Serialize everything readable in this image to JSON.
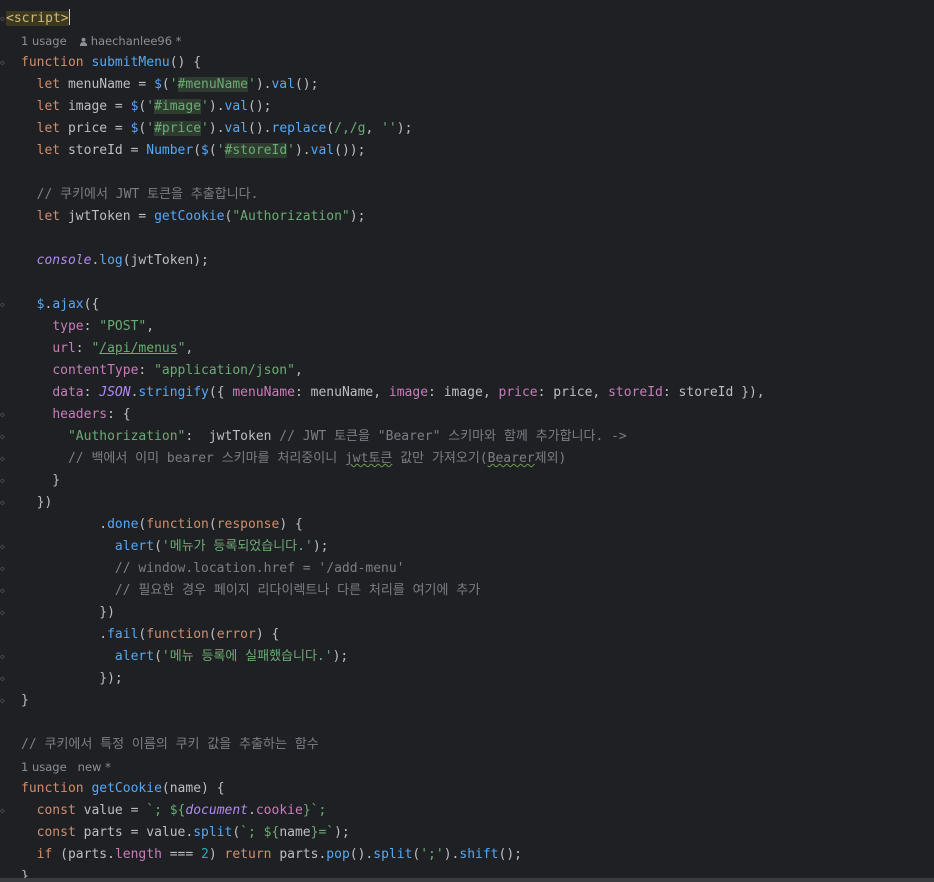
{
  "editor": {
    "lines": [
      {
        "tokens": [
          {
            "t": "<script>",
            "c": "hl-tag"
          }
        ],
        "caret": true
      },
      {
        "meta": true,
        "usage": "1 usage",
        "author": "haechanlee96 *"
      },
      {
        "tokens": [
          {
            "t": "function ",
            "c": "kw"
          },
          {
            "t": "submitMenu",
            "c": "fn"
          },
          {
            "t": "() {"
          }
        ]
      },
      {
        "tokens": [
          {
            "t": "  "
          },
          {
            "t": "let ",
            "c": "kw"
          },
          {
            "t": "menuName = "
          },
          {
            "t": "$",
            "c": "fn"
          },
          {
            "t": "("
          },
          {
            "t": "'",
            "c": "str"
          },
          {
            "t": "#menuName",
            "c": "str id-hl"
          },
          {
            "t": "'",
            "c": "str"
          },
          {
            "t": ")."
          },
          {
            "t": "val",
            "c": "fn"
          },
          {
            "t": "();"
          }
        ]
      },
      {
        "tokens": [
          {
            "t": "  "
          },
          {
            "t": "let ",
            "c": "kw"
          },
          {
            "t": "image = "
          },
          {
            "t": "$",
            "c": "fn"
          },
          {
            "t": "("
          },
          {
            "t": "'",
            "c": "str"
          },
          {
            "t": "#image",
            "c": "str id-hl"
          },
          {
            "t": "'",
            "c": "str"
          },
          {
            "t": ")."
          },
          {
            "t": "val",
            "c": "fn"
          },
          {
            "t": "();"
          }
        ]
      },
      {
        "tokens": [
          {
            "t": "  "
          },
          {
            "t": "let ",
            "c": "kw"
          },
          {
            "t": "price = "
          },
          {
            "t": "$",
            "c": "fn"
          },
          {
            "t": "("
          },
          {
            "t": "'",
            "c": "str"
          },
          {
            "t": "#price",
            "c": "str id-hl"
          },
          {
            "t": "'",
            "c": "str"
          },
          {
            "t": ")."
          },
          {
            "t": "val",
            "c": "fn"
          },
          {
            "t": "()."
          },
          {
            "t": "replace",
            "c": "fn"
          },
          {
            "t": "("
          },
          {
            "t": "/,/g",
            "c": "str"
          },
          {
            "t": ", "
          },
          {
            "t": "''",
            "c": "str"
          },
          {
            "t": ");"
          }
        ]
      },
      {
        "tokens": [
          {
            "t": "  "
          },
          {
            "t": "let ",
            "c": "kw"
          },
          {
            "t": "storeId = "
          },
          {
            "t": "Number",
            "c": "fn"
          },
          {
            "t": "("
          },
          {
            "t": "$",
            "c": "fn"
          },
          {
            "t": "("
          },
          {
            "t": "'",
            "c": "str"
          },
          {
            "t": "#storeId",
            "c": "str id-hl"
          },
          {
            "t": "'",
            "c": "str"
          },
          {
            "t": ")."
          },
          {
            "t": "val",
            "c": "fn"
          },
          {
            "t": "());"
          }
        ]
      },
      {
        "tokens": []
      },
      {
        "tokens": [
          {
            "t": "  "
          },
          {
            "t": "// 쿠키에서 JWT 토큰을 추출합니다.",
            "c": "cm"
          }
        ]
      },
      {
        "tokens": [
          {
            "t": "  "
          },
          {
            "t": "let ",
            "c": "kw"
          },
          {
            "t": "jwtToken = "
          },
          {
            "t": "getCookie",
            "c": "fn"
          },
          {
            "t": "("
          },
          {
            "t": "\"Authorization\"",
            "c": "str"
          },
          {
            "t": ");"
          }
        ]
      },
      {
        "tokens": []
      },
      {
        "tokens": [
          {
            "t": "  "
          },
          {
            "t": "console",
            "c": "ctx"
          },
          {
            "t": "."
          },
          {
            "t": "log",
            "c": "fn"
          },
          {
            "t": "(jwtToken);"
          }
        ]
      },
      {
        "tokens": []
      },
      {
        "tokens": [
          {
            "t": "  "
          },
          {
            "t": "$",
            "c": "fn"
          },
          {
            "t": "."
          },
          {
            "t": "ajax",
            "c": "fn"
          },
          {
            "t": "({"
          }
        ]
      },
      {
        "tokens": [
          {
            "t": "    "
          },
          {
            "t": "type",
            "c": "prop"
          },
          {
            "t": ": "
          },
          {
            "t": "\"POST\"",
            "c": "str"
          },
          {
            "t": ","
          }
        ]
      },
      {
        "tokens": [
          {
            "t": "    "
          },
          {
            "t": "url",
            "c": "prop"
          },
          {
            "t": ": "
          },
          {
            "t": "\"",
            "c": "str"
          },
          {
            "t": "/api/menus",
            "c": "str link"
          },
          {
            "t": "\"",
            "c": "str"
          },
          {
            "t": ","
          }
        ]
      },
      {
        "tokens": [
          {
            "t": "    "
          },
          {
            "t": "contentType",
            "c": "prop"
          },
          {
            "t": ": "
          },
          {
            "t": "\"application/json\"",
            "c": "str"
          },
          {
            "t": ","
          }
        ]
      },
      {
        "tokens": [
          {
            "t": "    "
          },
          {
            "t": "data",
            "c": "prop"
          },
          {
            "t": ": "
          },
          {
            "t": "JSON",
            "c": "ctx"
          },
          {
            "t": "."
          },
          {
            "t": "stringify",
            "c": "fn"
          },
          {
            "t": "({ "
          },
          {
            "t": "menuName",
            "c": "prop"
          },
          {
            "t": ": menuName, "
          },
          {
            "t": "image",
            "c": "prop"
          },
          {
            "t": ": image, "
          },
          {
            "t": "price",
            "c": "prop"
          },
          {
            "t": ": price, "
          },
          {
            "t": "storeId",
            "c": "prop"
          },
          {
            "t": ": storeId }),"
          }
        ]
      },
      {
        "tokens": [
          {
            "t": "    "
          },
          {
            "t": "headers",
            "c": "prop"
          },
          {
            "t": ": {"
          }
        ]
      },
      {
        "tokens": [
          {
            "t": "      "
          },
          {
            "t": "\"Authorization\"",
            "c": "str"
          },
          {
            "t": ":  jwtToken "
          },
          {
            "t": "// JWT 토큰을 \"Bearer\" 스키마와 함께 추가합니다. ->",
            "c": "cm"
          }
        ]
      },
      {
        "tokens": [
          {
            "t": "      "
          },
          {
            "t": "// 백에서 이미 bearer 스키마를 처리중이니 ",
            "c": "cm"
          },
          {
            "t": "jwt토큰",
            "c": "cm squig"
          },
          {
            "t": " 값만 가져오기(",
            "c": "cm"
          },
          {
            "t": "Bearer",
            "c": "cm squig"
          },
          {
            "t": "제외)",
            "c": "cm"
          }
        ]
      },
      {
        "tokens": [
          {
            "t": "    }"
          }
        ]
      },
      {
        "tokens": [
          {
            "t": "  })"
          }
        ]
      },
      {
        "tokens": [
          {
            "t": "          ."
          },
          {
            "t": "done",
            "c": "fn"
          },
          {
            "t": "("
          },
          {
            "t": "function",
            "c": "kw"
          },
          {
            "t": "("
          },
          {
            "t": "response",
            "c": "kw"
          },
          {
            "t": ") {"
          }
        ]
      },
      {
        "tokens": [
          {
            "t": "            "
          },
          {
            "t": "alert",
            "c": "fn"
          },
          {
            "t": "("
          },
          {
            "t": "'메뉴가 등록되었습니다.'",
            "c": "str"
          },
          {
            "t": ");"
          }
        ]
      },
      {
        "tokens": [
          {
            "t": "            "
          },
          {
            "t": "// window.location.href = '/add-menu'",
            "c": "cm"
          }
        ]
      },
      {
        "tokens": [
          {
            "t": "            "
          },
          {
            "t": "// 필요한 경우 페이지 리다이렉트나 다른 처리를 여기에 추가",
            "c": "cm"
          }
        ]
      },
      {
        "tokens": [
          {
            "t": "          })"
          }
        ]
      },
      {
        "tokens": [
          {
            "t": "          ."
          },
          {
            "t": "fail",
            "c": "fn"
          },
          {
            "t": "("
          },
          {
            "t": "function",
            "c": "kw"
          },
          {
            "t": "("
          },
          {
            "t": "error",
            "c": "kw"
          },
          {
            "t": ") {"
          }
        ]
      },
      {
        "tokens": [
          {
            "t": "            "
          },
          {
            "t": "alert",
            "c": "fn"
          },
          {
            "t": "("
          },
          {
            "t": "'메뉴 등록에 실패했습니다.'",
            "c": "str"
          },
          {
            "t": ");"
          }
        ]
      },
      {
        "tokens": [
          {
            "t": "          });"
          }
        ]
      },
      {
        "tokens": [
          {
            "t": "}"
          }
        ]
      },
      {
        "tokens": []
      },
      {
        "tokens": [
          {
            "t": "// 쿠키에서 특정 이름의 쿠키 값을 추출하는 함수",
            "c": "cm"
          }
        ]
      },
      {
        "meta": true,
        "usage": "1 usage",
        "author": "new *"
      },
      {
        "tokens": [
          {
            "t": "function ",
            "c": "kw"
          },
          {
            "t": "getCookie",
            "c": "fn"
          },
          {
            "t": "(name) {"
          }
        ]
      },
      {
        "tokens": [
          {
            "t": "  "
          },
          {
            "t": "const ",
            "c": "kw"
          },
          {
            "t": "value = "
          },
          {
            "t": "`; ${",
            "c": "str"
          },
          {
            "t": "document",
            "c": "ctx"
          },
          {
            "t": "."
          },
          {
            "t": "cookie",
            "c": "prop"
          },
          {
            "t": "}`;",
            "c": "str"
          }
        ]
      },
      {
        "tokens": [
          {
            "t": "  "
          },
          {
            "t": "const ",
            "c": "kw"
          },
          {
            "t": "parts = value."
          },
          {
            "t": "split",
            "c": "fn"
          },
          {
            "t": "("
          },
          {
            "t": "`; ${",
            "c": "str"
          },
          {
            "t": "name"
          },
          {
            "t": "}=`",
            "c": "str"
          },
          {
            "t": ");"
          }
        ]
      },
      {
        "tokens": [
          {
            "t": "  "
          },
          {
            "t": "if ",
            "c": "kw"
          },
          {
            "t": "(parts."
          },
          {
            "t": "length",
            "c": "prop"
          },
          {
            "t": " === "
          },
          {
            "t": "2",
            "c": "num"
          },
          {
            "t": ") "
          },
          {
            "t": "return ",
            "c": "kw"
          },
          {
            "t": "parts."
          },
          {
            "t": "pop",
            "c": "fn"
          },
          {
            "t": "()."
          },
          {
            "t": "split",
            "c": "fn"
          },
          {
            "t": "("
          },
          {
            "t": "';'",
            "c": "str"
          },
          {
            "t": ")."
          },
          {
            "t": "shift",
            "c": "fn"
          },
          {
            "t": "();"
          }
        ]
      },
      {
        "tokens": [
          {
            "t": "}"
          }
        ]
      }
    ]
  }
}
